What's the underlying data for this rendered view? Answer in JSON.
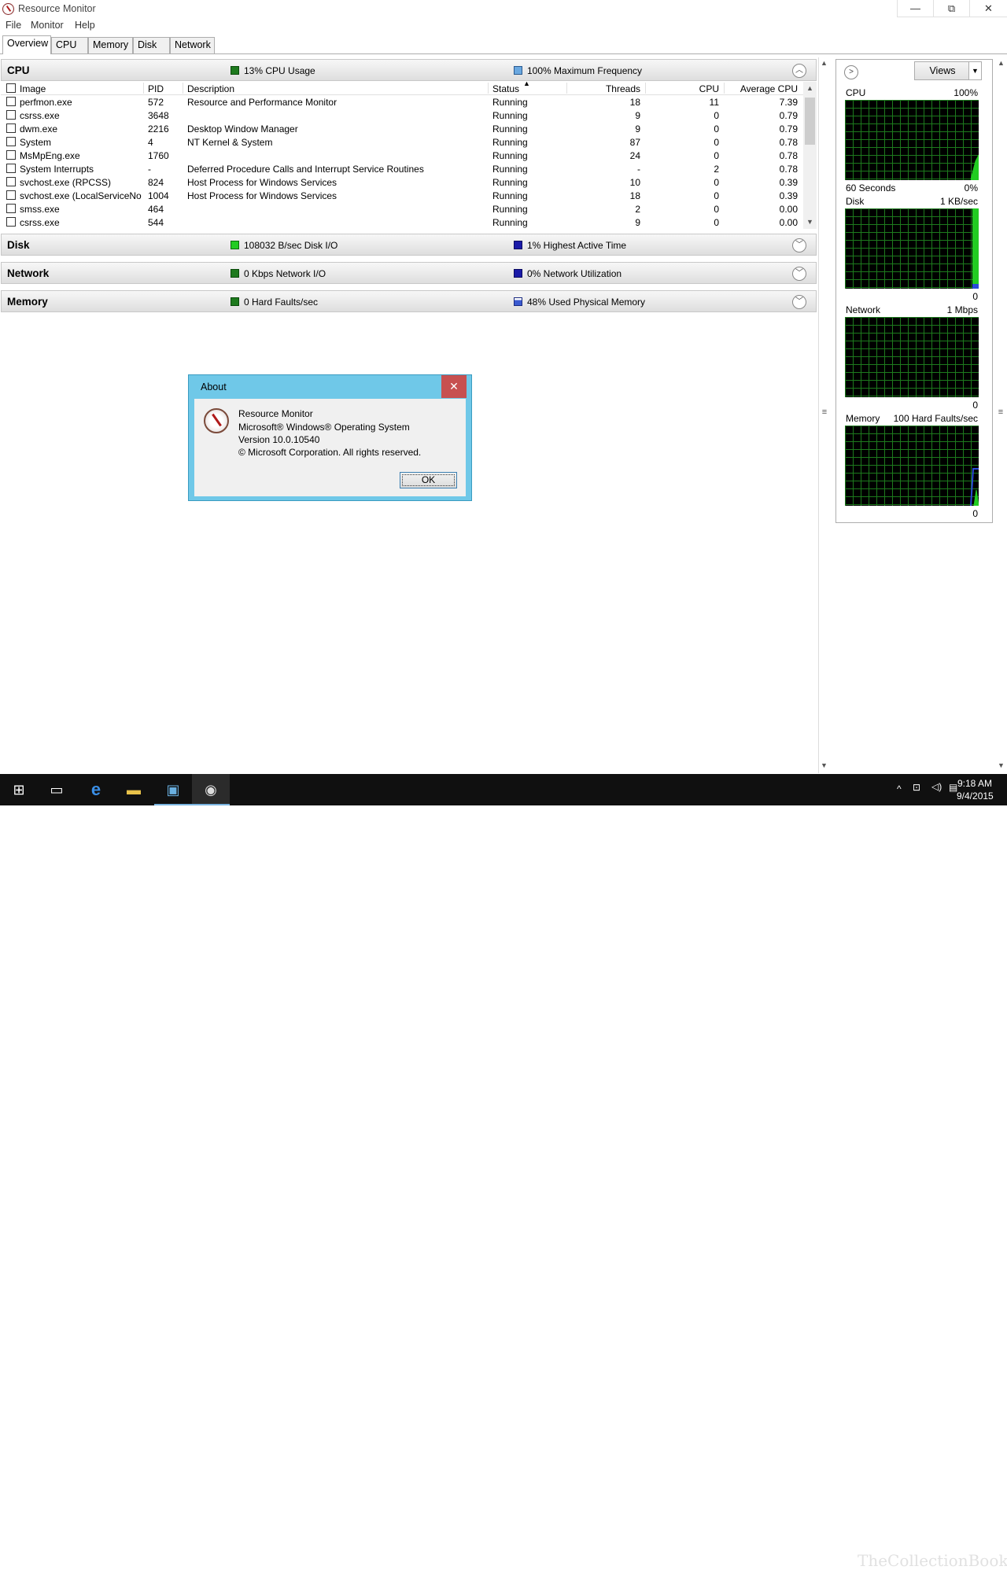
{
  "window": {
    "title": "Resource Monitor",
    "minimize": "—",
    "restore": "⧉",
    "close": "✕"
  },
  "menu": [
    "File",
    "Monitor",
    "Help"
  ],
  "tabs": [
    "Overview",
    "CPU",
    "Memory",
    "Disk",
    "Network"
  ],
  "cpu_section": {
    "name": "CPU",
    "stat1": "13% CPU Usage",
    "stat2": "100% Maximum Frequency",
    "stat1_color": "#1e7a1e",
    "stat2_color": "#6aa8e0",
    "columns": [
      "Image",
      "PID",
      "Description",
      "Status",
      "Threads",
      "CPU",
      "Average CPU"
    ],
    "rows": [
      [
        "perfmon.exe",
        "572",
        "Resource and Performance Monitor",
        "Running",
        "18",
        "11",
        "7.39"
      ],
      [
        "csrss.exe",
        "3648",
        "",
        "Running",
        "9",
        "0",
        "0.79"
      ],
      [
        "dwm.exe",
        "2216",
        "Desktop Window Manager",
        "Running",
        "9",
        "0",
        "0.79"
      ],
      [
        "System",
        "4",
        "NT Kernel & System",
        "Running",
        "87",
        "0",
        "0.78"
      ],
      [
        "MsMpEng.exe",
        "1760",
        "",
        "Running",
        "24",
        "0",
        "0.78"
      ],
      [
        "System Interrupts",
        "-",
        "Deferred Procedure Calls and Interrupt Service Routines",
        "Running",
        "-",
        "2",
        "0.78"
      ],
      [
        "svchost.exe (RPCSS)",
        "824",
        "Host Process for Windows Services",
        "Running",
        "10",
        "0",
        "0.39"
      ],
      [
        "svchost.exe (LocalServiceNo...",
        "1004",
        "Host Process for Windows Services",
        "Running",
        "18",
        "0",
        "0.39"
      ],
      [
        "smss.exe",
        "464",
        "",
        "Running",
        "2",
        "0",
        "0.00"
      ],
      [
        "csrss.exe",
        "544",
        "",
        "Running",
        "9",
        "0",
        "0.00"
      ]
    ]
  },
  "disk_section": {
    "name": "Disk",
    "stat1": "108032 B/sec Disk I/O",
    "stat2": "1% Highest Active Time",
    "stat1_color": "#22cc22",
    "stat2_color": "#1a1aa8"
  },
  "network_section": {
    "name": "Network",
    "stat1": "0 Kbps Network I/O",
    "stat2": "0% Network Utilization",
    "stat1_color": "#1e7a1e",
    "stat2_color": "#1a1aa8"
  },
  "memory_section": {
    "name": "Memory",
    "stat1": "0 Hard Faults/sec",
    "stat2": "48% Used Physical Memory",
    "stat1_color": "#1e7a1e",
    "stat2_color": "#3a5ad0"
  },
  "right_panel": {
    "views_label": "Views",
    "graphs": [
      {
        "name": "CPU",
        "max": "100%",
        "footer_left": "60 Seconds",
        "footer_right": "0%"
      },
      {
        "name": "Disk",
        "max": "1 KB/sec",
        "footer_left": "",
        "footer_right": "0"
      },
      {
        "name": "Network",
        "max": "1 Mbps",
        "footer_left": "",
        "footer_right": "0"
      },
      {
        "name": "Memory",
        "max": "100 Hard Faults/sec",
        "footer_left": "",
        "footer_right": "0"
      }
    ]
  },
  "about_dialog": {
    "title": "About",
    "lines": [
      "Resource Monitor",
      "Microsoft® Windows® Operating System",
      "Version 10.0.10540",
      "© Microsoft Corporation. All rights reserved."
    ],
    "ok_label": "OK"
  },
  "taskbar": {
    "time": "9:18 AM",
    "date": "9/4/2015",
    "watermark": "TheCollectionBook"
  }
}
